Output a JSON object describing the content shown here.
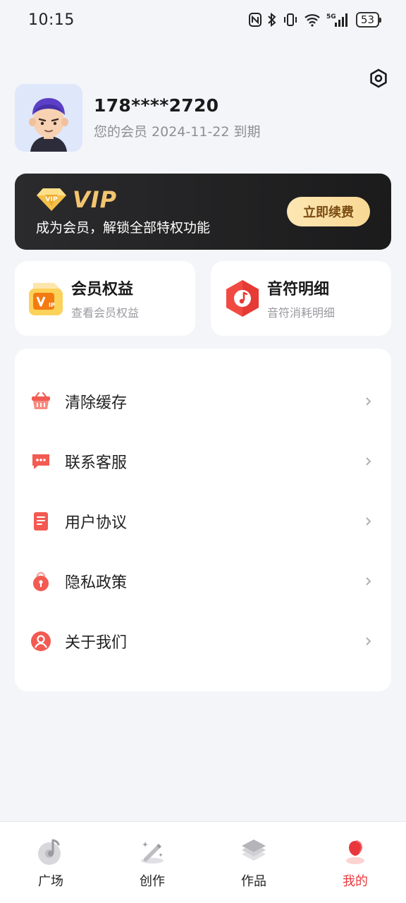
{
  "status_bar": {
    "time": "10:15",
    "network": "5G",
    "battery": "53"
  },
  "profile": {
    "phone": "178****2720",
    "expire_text": "您的会员 2024-11-22 到期"
  },
  "vip_banner": {
    "logo_text": "VIP",
    "badge_text": "VIP",
    "subtitle": "成为会员，解锁全部特权功能",
    "button_label": "立即续费"
  },
  "cards": [
    {
      "title": "会员权益",
      "subtitle": "查看会员权益",
      "icon": "vip-card-icon"
    },
    {
      "title": "音符明细",
      "subtitle": "音符消耗明细",
      "icon": "music-note-icon"
    }
  ],
  "menu": [
    {
      "label": "清除缓存",
      "icon": "basket-icon"
    },
    {
      "label": "联系客服",
      "icon": "chat-icon"
    },
    {
      "label": "用户协议",
      "icon": "document-icon"
    },
    {
      "label": "隐私政策",
      "icon": "lock-icon"
    },
    {
      "label": "关于我们",
      "icon": "person-icon"
    }
  ],
  "tabbar": [
    {
      "label": "广场",
      "icon": "music-disc-icon",
      "active": false
    },
    {
      "label": "创作",
      "icon": "magic-pen-icon",
      "active": false
    },
    {
      "label": "作品",
      "icon": "layers-icon",
      "active": false
    },
    {
      "label": "我的",
      "icon": "profile-icon",
      "active": true
    }
  ],
  "colors": {
    "accent": "#e8383d",
    "vip_gold": "#f3c56f",
    "background": "#f4f5f9"
  }
}
